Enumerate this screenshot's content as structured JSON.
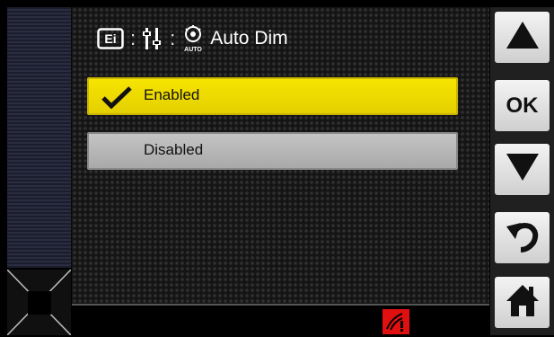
{
  "header": {
    "separator": ":",
    "title": "Auto Dim",
    "icons": [
      "info-display-icon",
      "settings-icon",
      "auto-dim-icon"
    ]
  },
  "options": [
    {
      "label": "Enabled",
      "selected": true,
      "icon": "checkmark-icon"
    },
    {
      "label": "Disabled",
      "selected": false
    }
  ],
  "nav": {
    "up_icon": "arrow-up-icon",
    "ok_label": "OK",
    "down_icon": "arrow-down-icon",
    "back_icon": "back-arrow-icon",
    "home_icon": "home-icon"
  },
  "status": {
    "alert_icon": "alert-icon"
  },
  "colors": {
    "selected": "#f2e000",
    "unselected": "#b8b8b8",
    "alert": "#e01010"
  }
}
